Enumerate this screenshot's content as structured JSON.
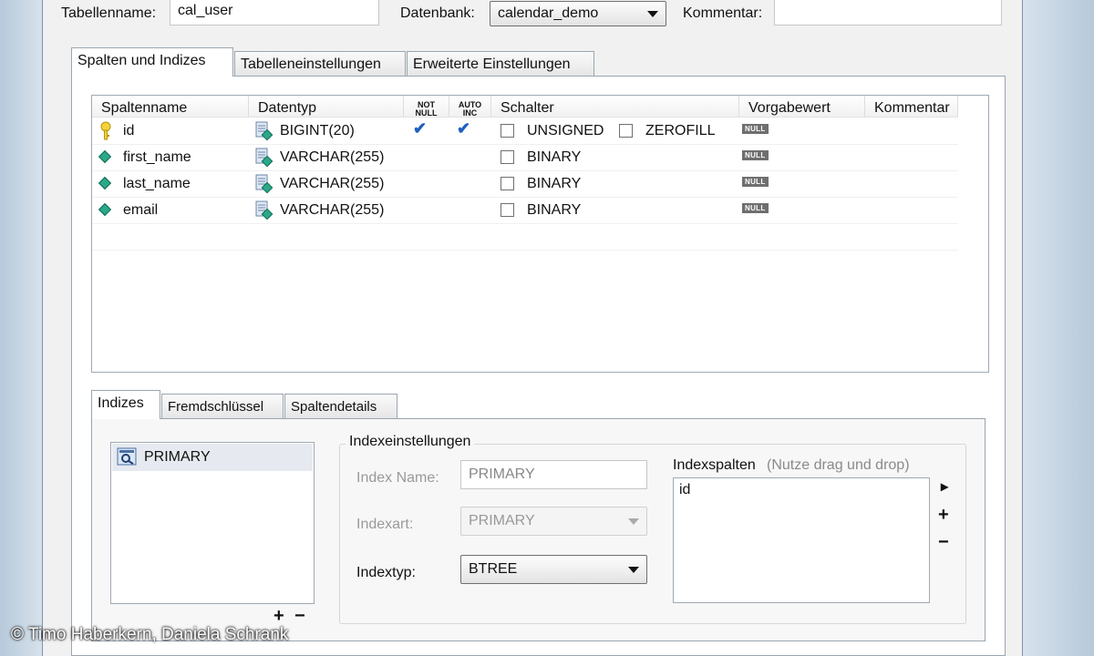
{
  "header": {
    "table_name_label": "Tabellenname:",
    "table_name_value": "cal_user",
    "database_label": "Datenbank:",
    "database_value": "calendar_demo",
    "comment_label": "Kommentar:",
    "comment_value": ""
  },
  "main_tabs": [
    "Spalten und Indizes",
    "Tabelleneinstellungen",
    "Erweiterte Einstellungen"
  ],
  "columns_grid": {
    "headers": {
      "name": "Spaltenname",
      "type": "Datentyp",
      "not_null": "NOT NULL",
      "auto_inc": "AUTO INC",
      "flags": "Schalter",
      "default": "Vorgabewert",
      "comment": "Kommentar"
    },
    "rows": [
      {
        "name": "id",
        "type": "BIGINT(20)",
        "not_null": true,
        "auto_inc": true,
        "flag1": "UNSIGNED",
        "flag2": "ZEROFILL",
        "default": "NULL",
        "icon": "key-icon"
      },
      {
        "name": "first_name",
        "type": "VARCHAR(255)",
        "not_null": false,
        "auto_inc": false,
        "flag1": "BINARY",
        "flag2": "",
        "default": "NULL",
        "icon": "column-diamond-icon"
      },
      {
        "name": "last_name",
        "type": "VARCHAR(255)",
        "not_null": false,
        "auto_inc": false,
        "flag1": "BINARY",
        "flag2": "",
        "default": "NULL",
        "icon": "column-diamond-icon"
      },
      {
        "name": "email",
        "type": "VARCHAR(255)",
        "not_null": false,
        "auto_inc": false,
        "flag1": "BINARY",
        "flag2": "",
        "default": "NULL",
        "icon": "column-diamond-icon"
      }
    ]
  },
  "sub_tabs": [
    "Indizes",
    "Fremdschlüssel",
    "Spaltendetails"
  ],
  "index_list": [
    "PRIMARY"
  ],
  "index_list_buttons": {
    "add": "+",
    "remove": "−"
  },
  "index_settings": {
    "group_title": "Indexeinstellungen",
    "name_label": "Index Name:",
    "name_value": "PRIMARY",
    "kind_label": "Indexart:",
    "kind_value": "PRIMARY",
    "type_label": "Indextyp:",
    "type_value": "BTREE"
  },
  "index_columns": {
    "title": "Indexspalten",
    "hint": "(Nutze drag und drop)",
    "items": [
      "id"
    ],
    "buttons": {
      "move": "▸",
      "add": "+",
      "remove": "−"
    }
  },
  "watermark": "© Timo Haberkern, Daniela Schrank",
  "colors": {
    "accent": "#1e5fbf",
    "null_badge": "#6f6f6f",
    "diamond": "#2aa889"
  }
}
